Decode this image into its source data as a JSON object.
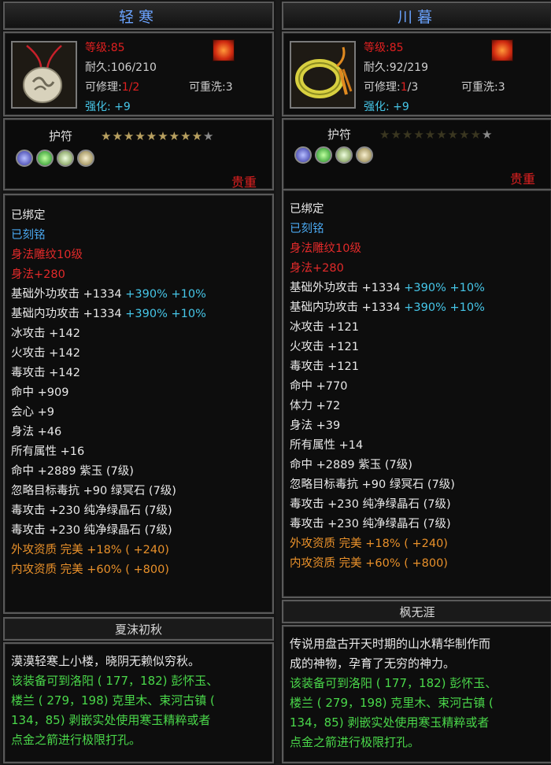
{
  "left": {
    "title": "轻寒",
    "level_label": "等级:",
    "level_value": "85",
    "durability_label": "耐久:",
    "durability_value": "106/210",
    "repair_label": "可修理:",
    "repair_current": "1",
    "repair_max": "/2",
    "rewash": "可重洗:3",
    "enhance_label": "强化: ",
    "enhance_value": "+9",
    "type": "护符",
    "stars": "★★★★★★★★★",
    "star_off": "★",
    "rarity": "贵重",
    "attributes": [
      {
        "main": "已绑定",
        "sub": "",
        "color": "c-white"
      },
      {
        "main": "已刻铭",
        "sub": "",
        "color": "c-blue"
      },
      {
        "main": "身法雕纹10级",
        "sub": "",
        "color": "c-red"
      },
      {
        "main": "身法+280",
        "sub": "",
        "color": "c-red"
      },
      {
        "main": "基础外功攻击 +1334",
        "sub": " +390% +10%",
        "color": "c-white"
      },
      {
        "main": "基础内功攻击 +1334",
        "sub": " +390% +10%",
        "color": "c-white"
      },
      {
        "main": "冰攻击 +142",
        "sub": "",
        "color": "c-white"
      },
      {
        "main": "火攻击 +142",
        "sub": "",
        "color": "c-white"
      },
      {
        "main": "毒攻击 +142",
        "sub": "",
        "color": "c-white"
      },
      {
        "main": "命中 +909",
        "sub": "",
        "color": "c-white"
      },
      {
        "main": "会心 +9",
        "sub": "",
        "color": "c-white"
      },
      {
        "main": "身法 +46",
        "sub": "",
        "color": "c-white"
      },
      {
        "main": "所有属性 +16",
        "sub": "",
        "color": "c-white"
      },
      {
        "main": "命中 +2889 紫玉 (7级)",
        "sub": "",
        "color": "c-white"
      },
      {
        "main": "忽略目标毒抗 +90 绿冥石 (7级)",
        "sub": "",
        "color": "c-white"
      },
      {
        "main": "毒攻击 +230 纯净绿晶石 (7级)",
        "sub": "",
        "color": "c-white"
      },
      {
        "main": "毒攻击 +230 纯净绿晶石 (7级)",
        "sub": "",
        "color": "c-white"
      },
      {
        "main": "外攻资质   完美 +18% ( +240)",
        "sub": "",
        "color": "c-orange"
      },
      {
        "main": "内攻资质   完美 +60% ( +800)",
        "sub": "",
        "color": "c-orange"
      }
    ],
    "name": "夏沫初秋",
    "desc_lines": [
      {
        "text": "漠漠轻寒上小楼，晓阴无赖似穷秋。",
        "color": "white"
      },
      {
        "text": "该装备可到洛阳 ( 177，182) 彭怀玉、",
        "color": "green"
      },
      {
        "text": "楼兰 ( 279，198) 克里木、束河古镇 (",
        "color": "green"
      },
      {
        "text": "134，85) 剥嵌实处使用寒玉精粹或者",
        "color": "green"
      },
      {
        "text": "点金之箭进行极限打孔。",
        "color": "green"
      }
    ]
  },
  "right": {
    "title": "川暮",
    "level_label": "等级:",
    "level_value": "85",
    "durability_label": "耐久:",
    "durability_value": "92/219",
    "repair_label": "可修理:",
    "repair_current": "1",
    "repair_max": "/3",
    "rewash": "可重洗:3",
    "enhance_label": "强化: ",
    "enhance_value": "+9",
    "type": "护符",
    "stars": "★★★★★★★★★",
    "star_off": "★",
    "rarity": "贵重",
    "attributes": [
      {
        "main": "已绑定",
        "sub": "",
        "color": "c-white"
      },
      {
        "main": "已刻铭",
        "sub": "",
        "color": "c-blue"
      },
      {
        "main": "身法雕纹10级",
        "sub": "",
        "color": "c-red"
      },
      {
        "main": "身法+280",
        "sub": "",
        "color": "c-red"
      },
      {
        "main": "基础外功攻击 +1334",
        "sub": " +390% +10%",
        "color": "c-white"
      },
      {
        "main": "基础内功攻击 +1334",
        "sub": " +390% +10%",
        "color": "c-white"
      },
      {
        "main": "冰攻击 +121",
        "sub": "",
        "color": "c-white"
      },
      {
        "main": "火攻击 +121",
        "sub": "",
        "color": "c-white"
      },
      {
        "main": "毒攻击 +121",
        "sub": "",
        "color": "c-white"
      },
      {
        "main": "命中 +770",
        "sub": "",
        "color": "c-white"
      },
      {
        "main": "体力 +72",
        "sub": "",
        "color": "c-white"
      },
      {
        "main": "身法 +39",
        "sub": "",
        "color": "c-white"
      },
      {
        "main": "所有属性 +14",
        "sub": "",
        "color": "c-white"
      },
      {
        "main": "命中 +2889 紫玉 (7级)",
        "sub": "",
        "color": "c-white"
      },
      {
        "main": "忽略目标毒抗 +90 绿冥石 (7级)",
        "sub": "",
        "color": "c-white"
      },
      {
        "main": "毒攻击 +230 纯净绿晶石 (7级)",
        "sub": "",
        "color": "c-white"
      },
      {
        "main": "毒攻击 +230 纯净绿晶石 (7级)",
        "sub": "",
        "color": "c-white"
      },
      {
        "main": "外攻资质   完美 +18% ( +240)",
        "sub": "",
        "color": "c-orange"
      },
      {
        "main": "内攻资质   完美 +60% ( +800)",
        "sub": "",
        "color": "c-orange"
      }
    ],
    "name": "枫无涯",
    "desc_lines": [
      {
        "text": "传说用盘古开天时期的山水精华制作而",
        "color": "white"
      },
      {
        "text": "成的神物，孕育了无穷的神力。",
        "color": "white"
      },
      {
        "text": "该装备可到洛阳 ( 177，182) 彭怀玉、",
        "color": "green"
      },
      {
        "text": "楼兰 ( 279，198) 克里木、束河古镇 (",
        "color": "green"
      },
      {
        "text": "134，85) 剥嵌实处使用寒玉精粹或者",
        "color": "green"
      },
      {
        "text": "点金之箭进行极限打孔。",
        "color": "green"
      }
    ]
  }
}
